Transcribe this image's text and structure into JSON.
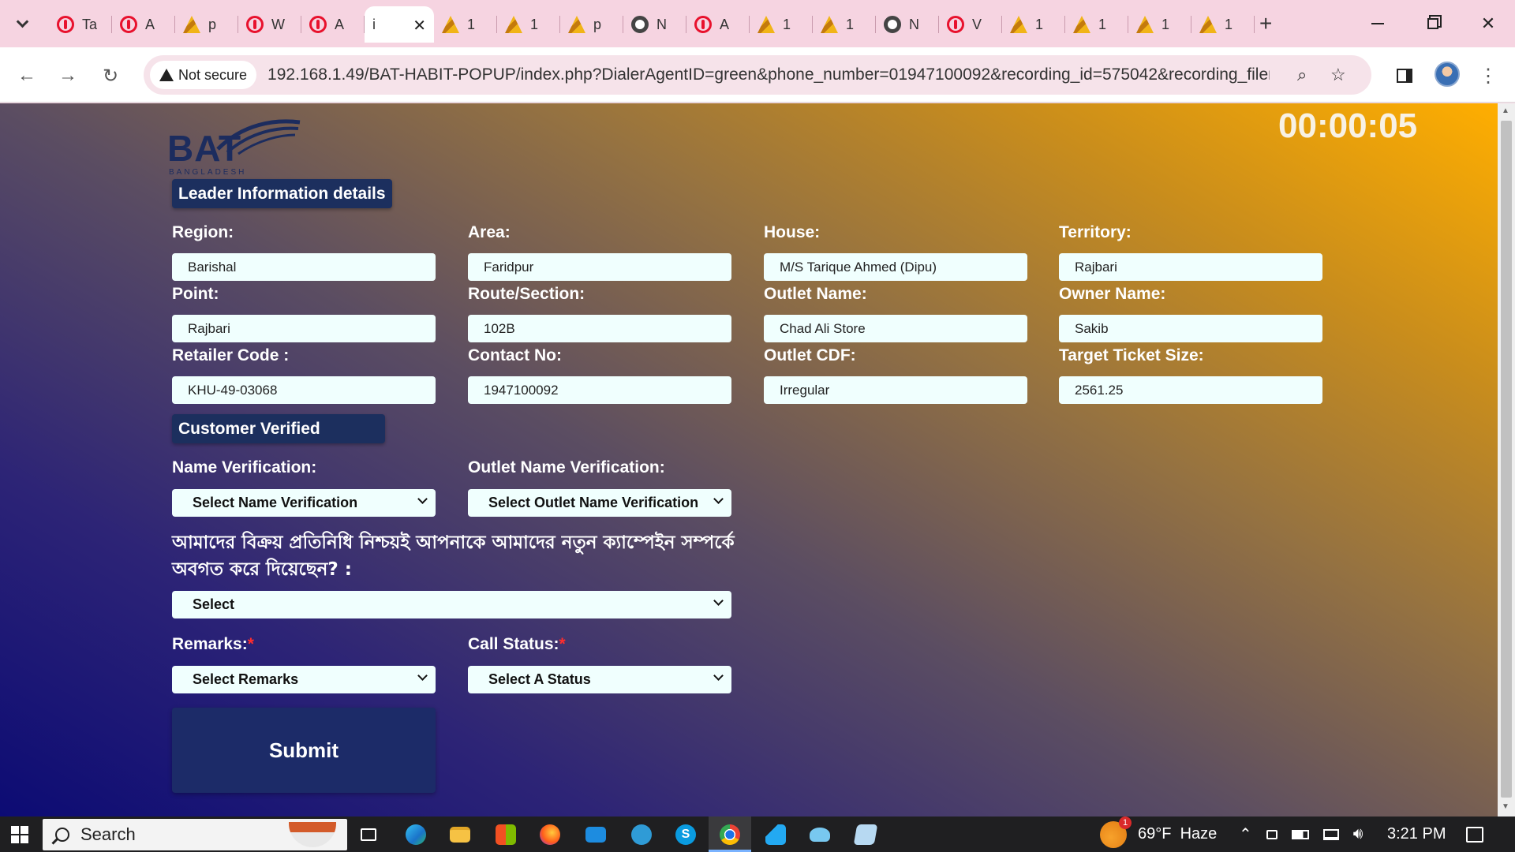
{
  "browser": {
    "tabs": [
      {
        "icon": "opera-icon",
        "title": "Ta"
      },
      {
        "icon": "opera-icon",
        "title": "A"
      },
      {
        "icon": "pma-icon",
        "title": "p"
      },
      {
        "icon": "opera-icon",
        "title": "W"
      },
      {
        "icon": "opera-icon",
        "title": "A"
      },
      {
        "icon": "page-icon",
        "title": "i",
        "active": true
      },
      {
        "icon": "pma-icon",
        "title": "1"
      },
      {
        "icon": "pma-icon",
        "title": "1"
      },
      {
        "icon": "pma-icon",
        "title": "p"
      },
      {
        "icon": "gear-icon",
        "title": "N"
      },
      {
        "icon": "opera-icon",
        "title": "A"
      },
      {
        "icon": "pma-icon",
        "title": "1"
      },
      {
        "icon": "pma-icon",
        "title": "1"
      },
      {
        "icon": "gear-icon",
        "title": "N"
      },
      {
        "icon": "opera-icon",
        "title": "V"
      },
      {
        "icon": "pma-icon",
        "title": "1"
      },
      {
        "icon": "pma-icon",
        "title": "1"
      },
      {
        "icon": "pma-icon",
        "title": "1"
      },
      {
        "icon": "pma-icon",
        "title": "1"
      }
    ],
    "security_label": "Not secure",
    "url": "192.168.1.49/BAT-HABIT-POPUP/index.php?DialerAgentID=green&phone_number=01947100092&recording_id=575042&recording_filena..."
  },
  "page": {
    "logo_text": "BAT",
    "logo_subtext": "BANGLADESH",
    "timer": "00:00:05",
    "leader_section_title": "Leader Information details",
    "fields": {
      "region": {
        "label": "Region:",
        "value": "Barishal"
      },
      "area": {
        "label": "Area:",
        "value": "Faridpur"
      },
      "house": {
        "label": "House:",
        "value": "M/S Tarique Ahmed (Dipu)"
      },
      "territory": {
        "label": "Territory:",
        "value": "Rajbari"
      },
      "point": {
        "label": "Point:",
        "value": "Rajbari"
      },
      "route": {
        "label": "Route/Section:",
        "value": "102B"
      },
      "outlet_name": {
        "label": "Outlet Name:",
        "value": "Chad Ali Store"
      },
      "owner_name": {
        "label": "Owner Name:",
        "value": "Sakib"
      },
      "retailer_code": {
        "label": "Retailer Code :",
        "value": "KHU-49-03068"
      },
      "contact_no": {
        "label": "Contact No:",
        "value": "1947100092"
      },
      "outlet_cdf": {
        "label": "Outlet CDF:",
        "value": "Irregular"
      },
      "target_ticket": {
        "label": "Target Ticket Size:",
        "value": "2561.25"
      }
    },
    "customer_section_title": "Customer Verified",
    "name_verification": {
      "label": "Name Verification:",
      "selected": "Select Name Verification"
    },
    "outlet_name_verification": {
      "label": "Outlet Name Verification:",
      "selected": "Select Outlet Name Verification"
    },
    "campaign_question": "আমাদের বিক্রয় প্রতিনিধি নিশ্চয়ই আপনাকে আমাদের নতুন ক্যাম্পেইন সম্পর্কে অবগত করে দিয়েছেন? :",
    "campaign_select": "Select",
    "remarks": {
      "label": "Remarks:",
      "required_mark": "*",
      "selected": "Select Remarks"
    },
    "call_status": {
      "label": "Call Status:",
      "required_mark": "*",
      "selected": "Select A Status"
    },
    "submit_label": "Submit"
  },
  "taskbar": {
    "search_placeholder": "Search",
    "weather": "69°F  Haze",
    "weather_badge": "1",
    "time": "3:21 PM"
  }
}
